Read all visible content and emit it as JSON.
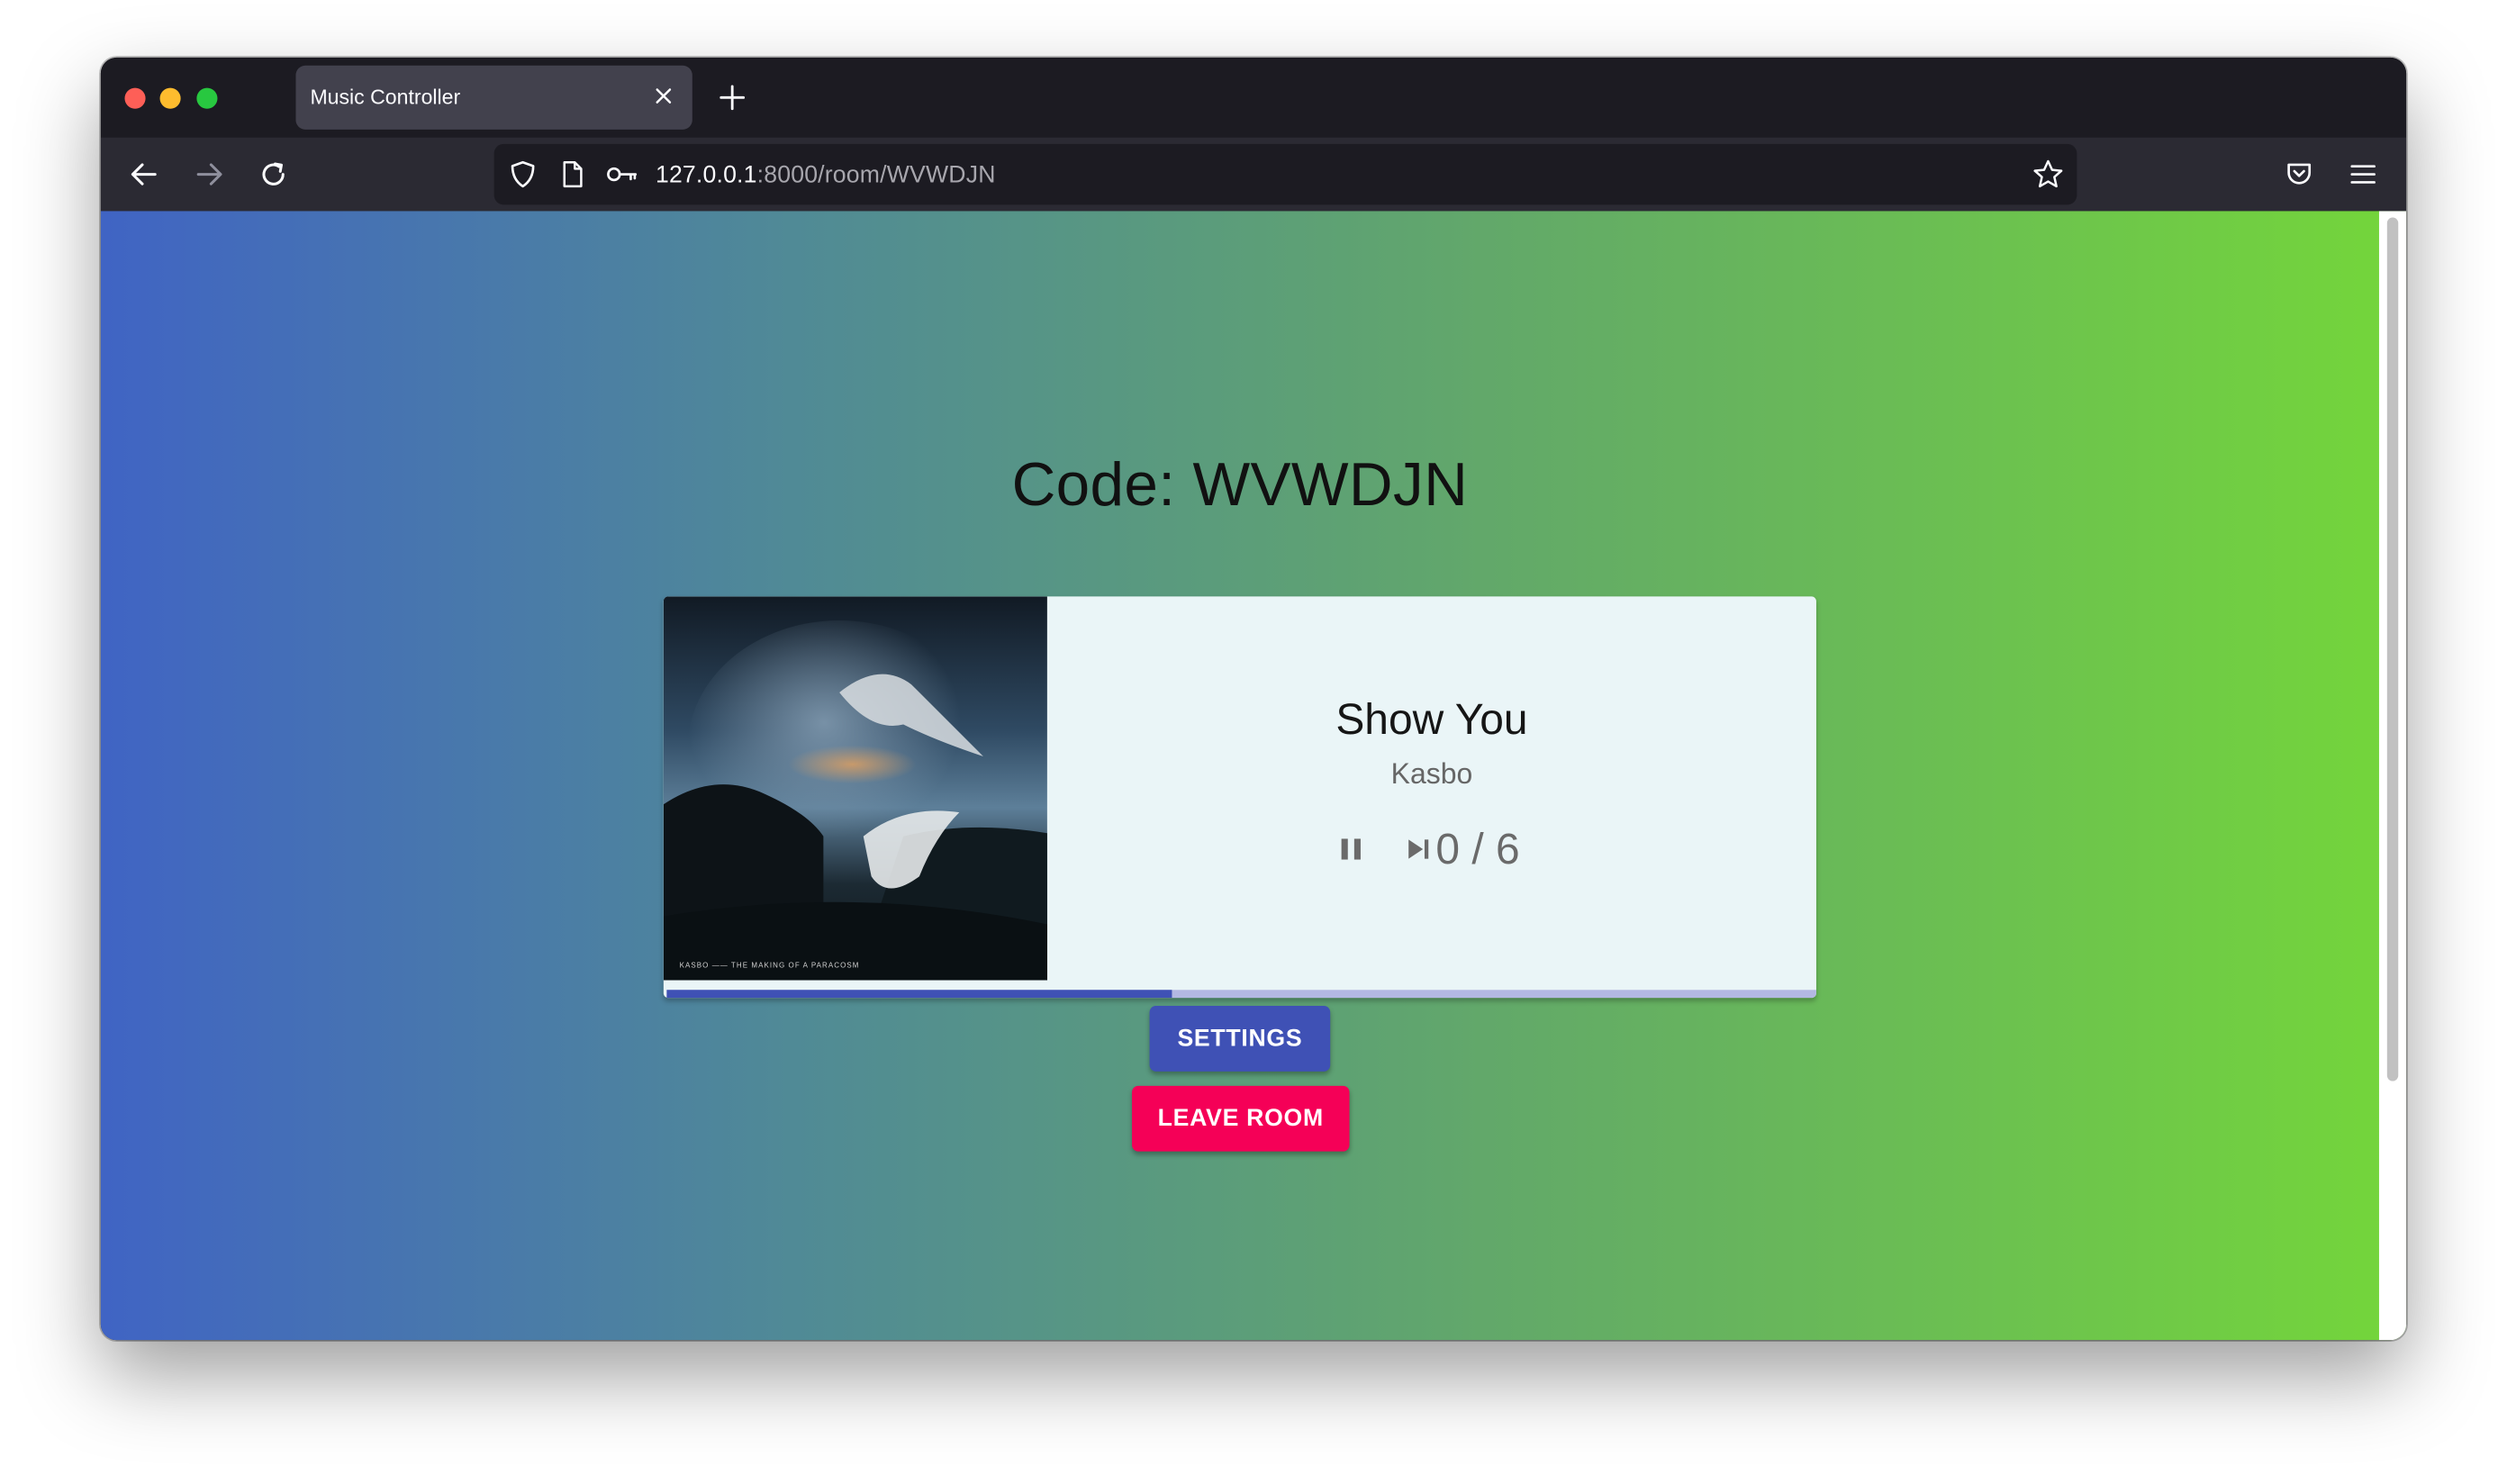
{
  "browser": {
    "tab_title": "Music Controller",
    "url_host": "127.0.0.1",
    "url_path": ":8000/room/WVWDJN"
  },
  "room": {
    "code_text": "Code: WVWDJN"
  },
  "player": {
    "song_title": "Show You",
    "artist": "Kasbo",
    "album_caption": "KASBO —— THE MAKING OF A PARACOSM",
    "votes_text": "0 / 6",
    "progress_fraction": 0.44,
    "is_playing": true
  },
  "buttons": {
    "settings_label": "SETTINGS",
    "leave_label": "LEAVE ROOM"
  },
  "colors": {
    "primary": "#3f51b5",
    "secondary": "#f50057",
    "card_bg": "#eaf5f7"
  },
  "icons": {
    "back": "arrow-left-icon",
    "forward": "arrow-right-icon",
    "reload": "reload-icon",
    "shield": "shield-icon",
    "page": "page-icon",
    "key": "key-icon",
    "bookmark": "star-icon",
    "pocket": "pocket-icon",
    "menu": "hamburger-menu-icon",
    "pause": "pause-icon",
    "skip": "skip-next-icon"
  }
}
